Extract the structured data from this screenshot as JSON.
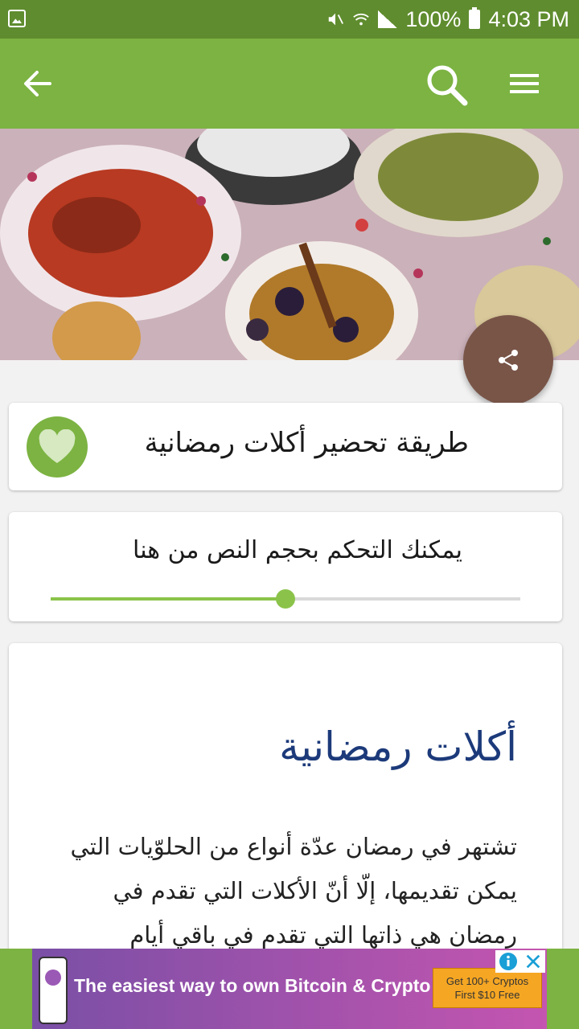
{
  "status_bar": {
    "battery": "100%",
    "time": "4:03 PM"
  },
  "app_bar": {
    "back_icon": "arrow-left-icon",
    "search_icon": "search-icon",
    "menu_icon": "menu-icon"
  },
  "hero": {
    "image_desc_icon": "food-image"
  },
  "share_button": {
    "icon": "share-icon",
    "color": "#795548"
  },
  "title_card": {
    "title": "طريقة تحضير أكلات رمضانية",
    "favorite_icon": "heart-icon"
  },
  "text_size_card": {
    "label": "يمكنك التحكم بحجم النص من هنا",
    "slider_value": 0.5
  },
  "article": {
    "heading": "أكلات رمضانية",
    "body": "تشتهر في رمضان عدّة أنواع من الحلوّيات التي يمكن تقديمها، إلّا أنّ الأكلات التي تقدم في رمضان هي ذاتها التي تقدم في باقي أيام"
  },
  "ad": {
    "text": "The easiest way to own Bitcoin & Crypto",
    "cta_line1": "Get 100+ Cryptos",
    "cta_line2": "First $10 Free"
  },
  "colors": {
    "status_bar": "#5f8c2e",
    "app_bar": "#7cb342",
    "accent": "#8bc34a",
    "heading": "#1c3a7a"
  }
}
